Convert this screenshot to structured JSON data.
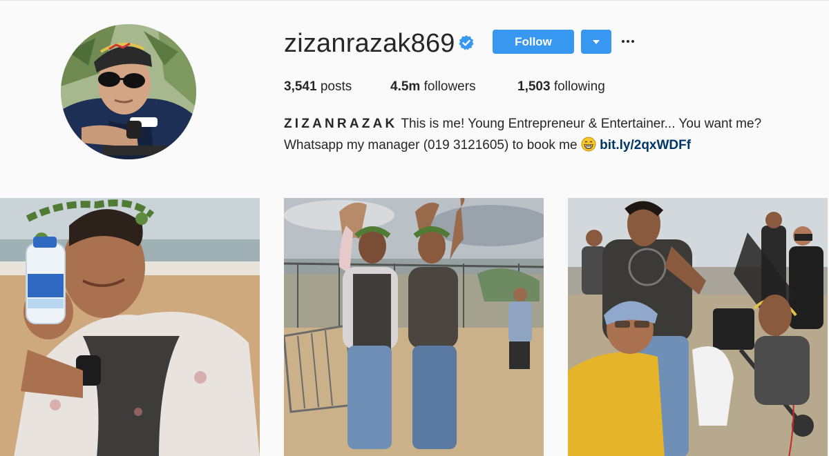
{
  "profile": {
    "username": "zizanrazak869",
    "verified": true,
    "verified_icon": "verified-badge-icon",
    "follow_label": "Follow",
    "dropdown_icon": "caret-down-icon",
    "more_icon": "ellipsis-icon",
    "accent_color": "#3897f0"
  },
  "stats": {
    "posts_count": "3,541",
    "posts_label": "posts",
    "followers_count": "4.5m",
    "followers_label": "followers",
    "following_count": "1,503",
    "following_label": "following"
  },
  "bio": {
    "name": "ZIZANRAZAK",
    "text_line1": "This is me! Young Entrepreneur & Entertainer... You want me?",
    "text_line2": "Whatsapp my manager (019 3121605) to book me",
    "emoji": "grinning-face-emoji",
    "link": "bit.ly/2qxWDFf",
    "link_color": "#003569"
  },
  "posts": [
    {
      "subject": "man with leaf crown holding Calpis bottle on beach"
    },
    {
      "subject": "two men with leaf crowns making heart shape with arms"
    },
    {
      "subject": "film crew on set with camera rig"
    }
  ]
}
